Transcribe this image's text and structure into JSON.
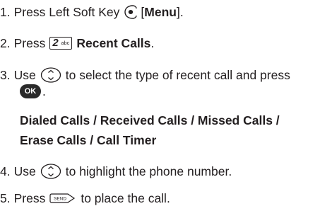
{
  "steps": [
    {
      "number": "1.",
      "before": "Press Left Soft Key",
      "icon": "left-soft-key-icon",
      "bracket_open": "[",
      "bold": "Menu",
      "bracket_close": "]."
    },
    {
      "number": "2.",
      "before": "Press",
      "key_digit": "2",
      "key_letters": "abc",
      "bold": "Recent Calls",
      "after": "."
    },
    {
      "number": "3.",
      "before": "Use",
      "icon": "navigation-key-icon",
      "after": "to select the type of recent call and press",
      "ok_label": "OK",
      "end": ".",
      "options_line1": "Dialed Calls / Received Calls / Missed Calls /",
      "options_line2": "Erase Calls / Call Timer"
    },
    {
      "number": "4.",
      "before": "Use",
      "icon": "navigation-key-icon",
      "after": "to highlight the phone number."
    },
    {
      "number": "5.",
      "before": "Press",
      "icon": "send-key-icon",
      "send_label": "SEND",
      "after": "to place the call."
    }
  ],
  "colors": {
    "text": "#231f20",
    "ok_key_fill": "#2a2a2a"
  }
}
